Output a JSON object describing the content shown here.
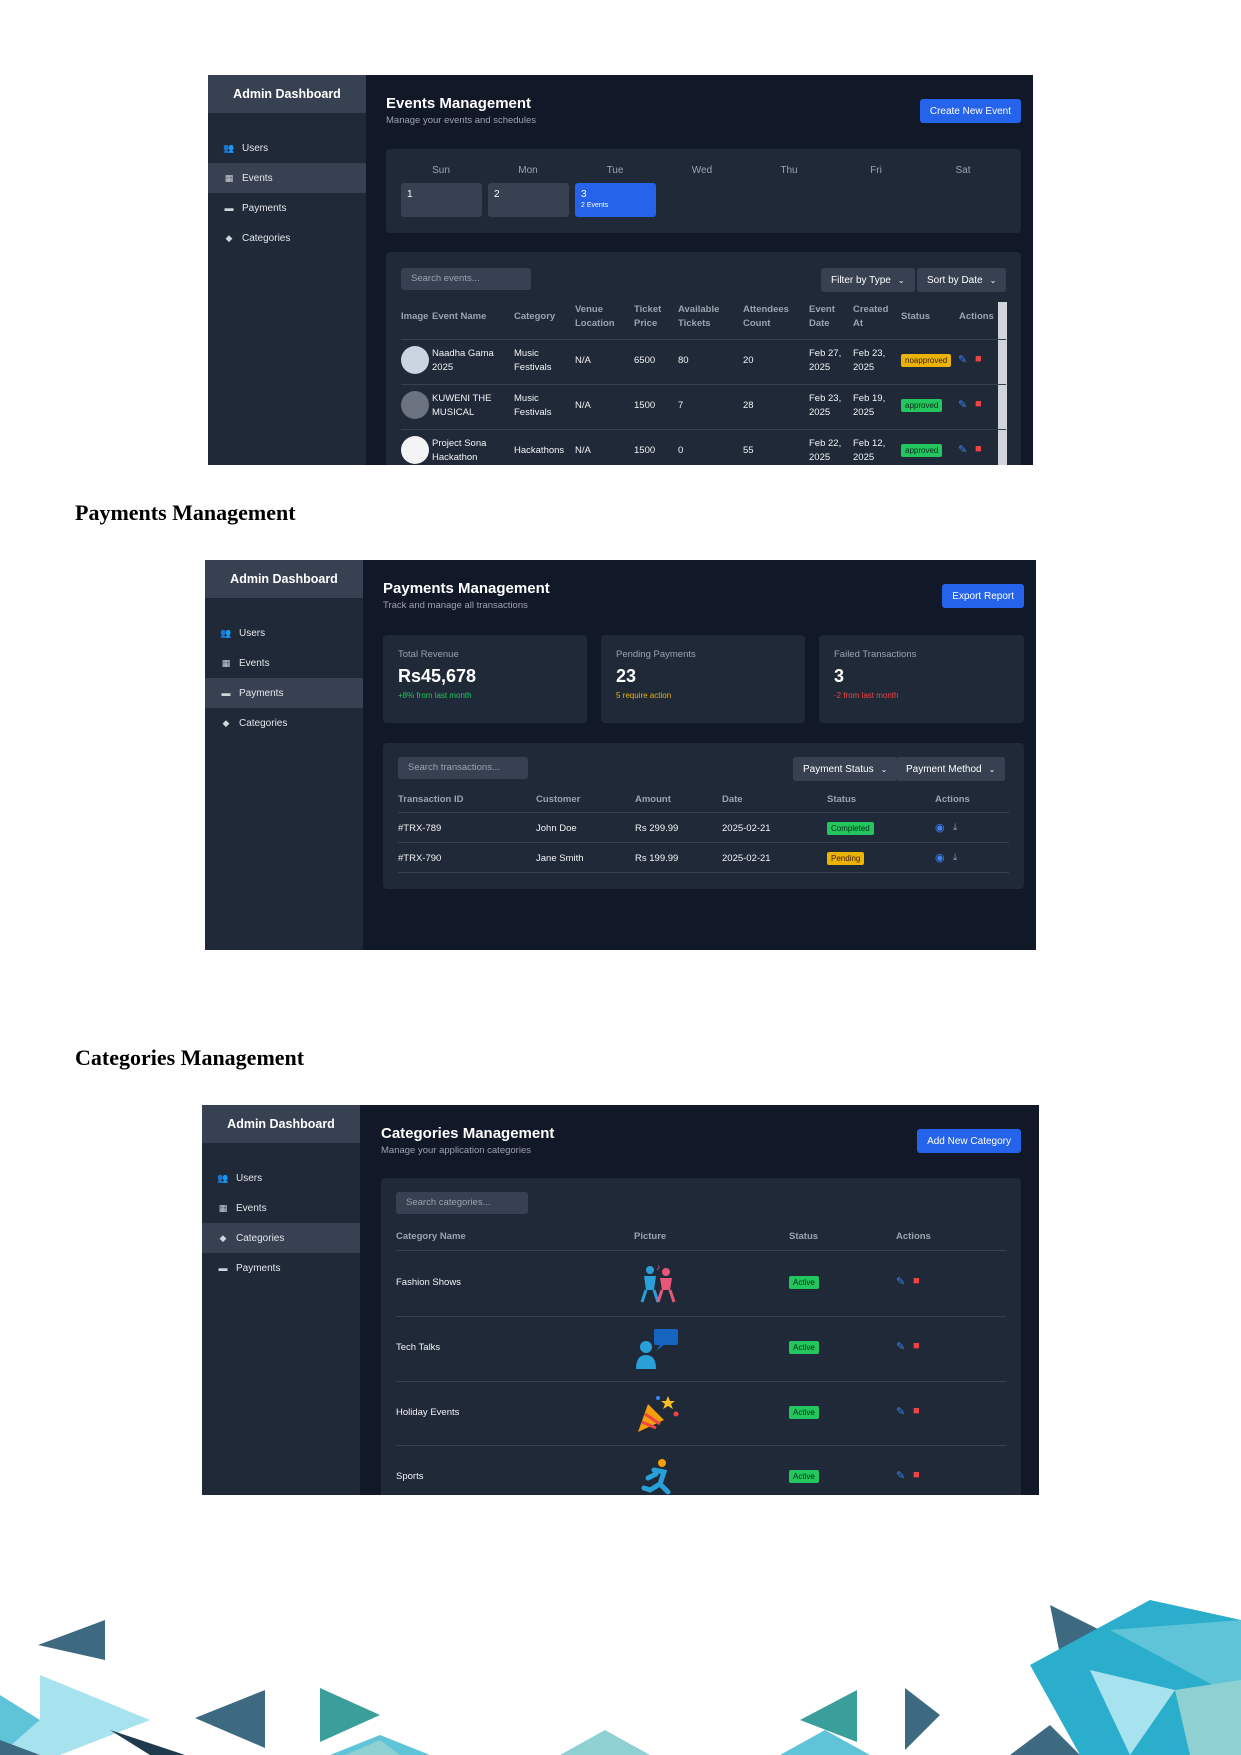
{
  "headings": {
    "payments": "Payments Management",
    "categories": "Categories Management"
  },
  "sidebar": {
    "title": "Admin Dashboard"
  },
  "events_shot": {
    "nav": [
      {
        "label": "Users",
        "icon": "users-icon",
        "glyph": "👥"
      },
      {
        "label": "Events",
        "icon": "calendar-icon",
        "glyph": "▦",
        "active": true
      },
      {
        "label": "Payments",
        "icon": "credit-card-icon",
        "glyph": "▬"
      },
      {
        "label": "Categories",
        "icon": "tags-icon",
        "glyph": "◆"
      }
    ],
    "title": "Events Management",
    "subtitle": "Manage your events and schedules",
    "button": "Create New Event",
    "calendar": {
      "days": [
        "Sun",
        "Mon",
        "Tue",
        "Wed",
        "Thu",
        "Fri",
        "Sat"
      ],
      "cells": [
        {
          "num": "1"
        },
        {
          "num": "2"
        },
        {
          "num": "3",
          "note": "2 Events"
        }
      ]
    },
    "search_placeholder": "Search events...",
    "filter": "Filter by Type",
    "sort": "Sort by Date",
    "columns": [
      [
        "Image"
      ],
      [
        "Event Name"
      ],
      [
        "Category"
      ],
      [
        "Venue",
        "Location"
      ],
      [
        "Ticket",
        "Price"
      ],
      [
        "Available",
        "Tickets"
      ],
      [
        "Attendees",
        "Count"
      ],
      [
        "Event",
        "Date"
      ],
      [
        "Created",
        "At"
      ],
      [
        "Status"
      ],
      [
        "Actions"
      ]
    ],
    "rows": [
      {
        "name": [
          "Naadha Gama",
          "2025"
        ],
        "category": [
          "Music",
          "Festivals"
        ],
        "venue": "N/A",
        "price": "6500",
        "available": "80",
        "attendees": "20",
        "event_date": [
          "Feb 27,",
          "2025"
        ],
        "created": [
          "Feb 23,",
          "2025"
        ],
        "status": "noapproved"
      },
      {
        "name": [
          "KUWENI THE",
          "MUSICAL"
        ],
        "category": [
          "Music",
          "Festivals"
        ],
        "venue": "N/A",
        "price": "1500",
        "available": "7",
        "attendees": "28",
        "event_date": [
          "Feb 23,",
          "2025"
        ],
        "created": [
          "Feb 19,",
          "2025"
        ],
        "status": "approved"
      },
      {
        "name": [
          "Project Sona",
          "Hackathon"
        ],
        "category": [
          "Hackathons"
        ],
        "venue": "N/A",
        "price": "1500",
        "available": "0",
        "attendees": "55",
        "event_date": [
          "Feb 22,",
          "2025"
        ],
        "created": [
          "Feb 12,",
          "2025"
        ],
        "status": "approved"
      }
    ]
  },
  "payments_shot": {
    "nav": [
      {
        "label": "Users",
        "icon": "users-icon",
        "glyph": "👥"
      },
      {
        "label": "Events",
        "icon": "calendar-icon",
        "glyph": "▦"
      },
      {
        "label": "Payments",
        "icon": "credit-card-icon",
        "glyph": "▬",
        "active": true
      },
      {
        "label": "Categories",
        "icon": "tags-icon",
        "glyph": "◆"
      }
    ],
    "title": "Payments Management",
    "subtitle": "Track and manage all transactions",
    "button": "Export Report",
    "stats": [
      {
        "label": "Total Revenue",
        "value": "Rs45,678",
        "note": "+8% from last month",
        "note_color": "#22c55e"
      },
      {
        "label": "Pending Payments",
        "value": "23",
        "note": "5 require action",
        "note_color": "#eab308"
      },
      {
        "label": "Failed Transactions",
        "value": "3",
        "note": "-2 from last month",
        "note_color": "#ef4444"
      }
    ],
    "search_placeholder": "Search transactions...",
    "filter_status": "Payment Status",
    "filter_method": "Payment Method",
    "columns": [
      "Transaction ID",
      "Customer",
      "Amount",
      "Date",
      "Status",
      "Actions"
    ],
    "rows": [
      {
        "id": "#TRX-789",
        "customer": "John Doe",
        "amount": "Rs 299.99",
        "date": "2025-02-21",
        "status": "Completed",
        "status_color": "#22c55e"
      },
      {
        "id": "#TRX-790",
        "customer": "Jane Smith",
        "amount": "Rs 199.99",
        "date": "2025-02-21",
        "status": "Pending",
        "status_color": "#eab308"
      }
    ]
  },
  "categories_shot": {
    "nav": [
      {
        "label": "Users",
        "icon": "users-icon",
        "glyph": "👥"
      },
      {
        "label": "Events",
        "icon": "calendar-icon",
        "glyph": "▦"
      },
      {
        "label": "Categories",
        "icon": "tags-icon",
        "glyph": "◆",
        "active": true
      },
      {
        "label": "Payments",
        "icon": "credit-card-icon",
        "glyph": "▬"
      }
    ],
    "title": "Categories Management",
    "subtitle": "Manage your application categories",
    "button": "Add New Category",
    "search_placeholder": "Search categories...",
    "columns": [
      "Category Name",
      "Picture",
      "Status",
      "Actions"
    ],
    "rows": [
      {
        "name": "Fashion Shows",
        "picture": "dancers-picture",
        "status": "Active"
      },
      {
        "name": "Tech Talks",
        "picture": "speaker-picture",
        "status": "Active"
      },
      {
        "name": "Holiday Events",
        "picture": "party-popper-picture",
        "status": "Active"
      },
      {
        "name": "Sports",
        "picture": "runner-picture",
        "status": "Active"
      }
    ]
  },
  "colors": {
    "accent": "#2563eb",
    "bg": "#111827",
    "panel": "#1f2937",
    "active": "#374151",
    "success": "#22c55e",
    "warning": "#eab308",
    "danger": "#ef4444"
  }
}
